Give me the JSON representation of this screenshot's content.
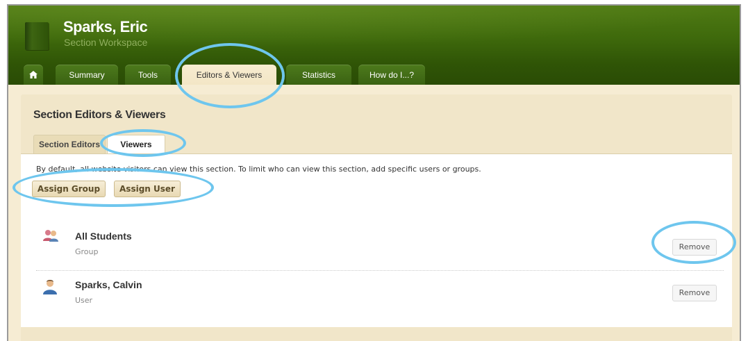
{
  "header": {
    "title": "Sparks, Eric",
    "subtitle": "Section Workspace"
  },
  "tabs": [
    {
      "label": "Summary"
    },
    {
      "label": "Tools"
    },
    {
      "label": "Editors & Viewers",
      "active": true
    },
    {
      "label": "Statistics"
    },
    {
      "label": "How do I...?"
    }
  ],
  "panel": {
    "title": "Section Editors & Viewers",
    "subtabs": [
      {
        "label": "Section Editors"
      },
      {
        "label": "Viewers",
        "active": true
      }
    ],
    "notice": "By default, all website visitors can view this section. To limit who can view this section, add specific users or groups.",
    "buttons": {
      "assign_group": "Assign Group",
      "assign_user": "Assign User"
    }
  },
  "viewers": [
    {
      "name": "All Students",
      "type": "Group",
      "icon": "group-icon",
      "action": "Remove"
    },
    {
      "name": "Sparks, Calvin",
      "type": "User",
      "icon": "user-icon",
      "action": "Remove"
    }
  ],
  "colors": {
    "header_green": "#3f6a0c",
    "tab_green": "#4d7a1c",
    "panel_beige": "#f1e6c9",
    "highlight_blue": "#6ec6ee"
  }
}
